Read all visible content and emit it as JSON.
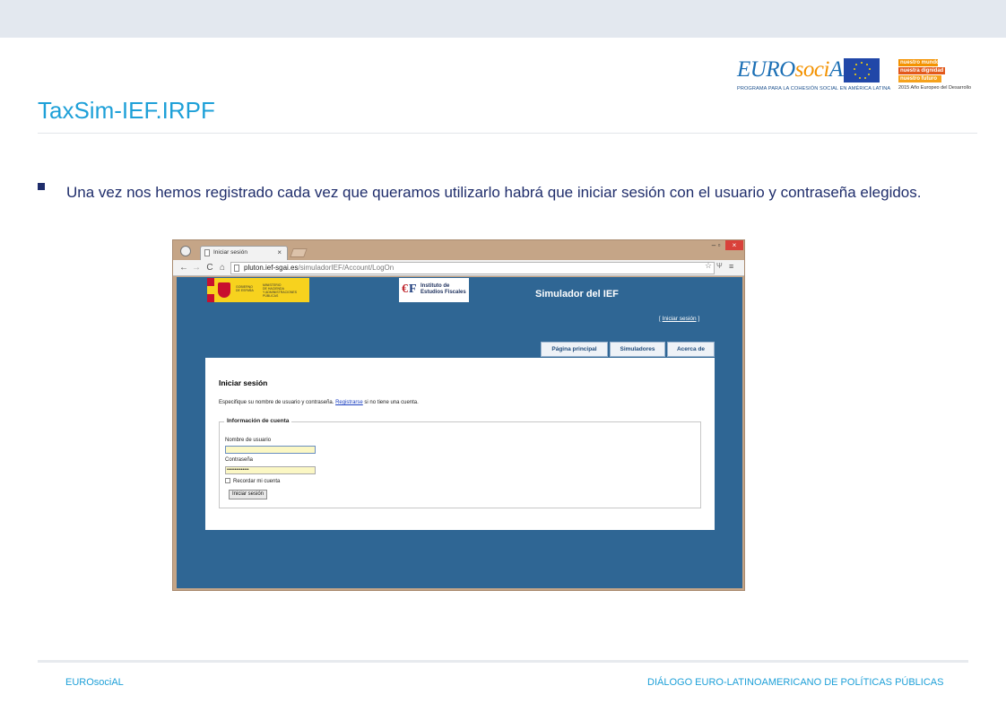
{
  "slide": {
    "title": "TaxSim-IEF.IRPF",
    "bullet": "Una vez nos hemos registrado cada vez que queramos utilizarlo habrá que iniciar sesión con el usuario y contraseña elegidos.",
    "footer_left": "EUROsociAL",
    "footer_right": "DIÁLOGO EURO-LATINOAMERICANO DE POLÍTICAS PÚBLICAS"
  },
  "logos": {
    "eurosocial_eu": "EURO",
    "eurosocial_soc": "soci",
    "eurosocial_al": "AL",
    "eurosocial_tagline": "PROGRAMA PARA LA COHESIÓN SOCIAL EN AMÉRICA LATINA",
    "nuestro_mundo": "nuestro mundo",
    "nuestra_dignidad": "nuestra dignidad",
    "nuestro_futuro": "nuestro futuro",
    "year_text": "2015 Año Europeo del Desarrollo"
  },
  "browser": {
    "tab_title": "Iniciar sesión",
    "tab_close": "×",
    "window_controls": {
      "minimize": "–",
      "maximize": "▫",
      "close": "×"
    },
    "nav": {
      "back": "←",
      "forward": "→",
      "reload": "C",
      "home": "⌂"
    },
    "url_host": "pluton.ief-sgai.es",
    "url_path": "/simuladorIEF/Account/LogOn",
    "star": "☆",
    "ext": "Ψ",
    "menu": "≡"
  },
  "site": {
    "gob_line1": "GOBIERNO\nDE ESPAÑA",
    "gob_line2": "MINISTERIO\nDE HACIENDA\nY ADMINISTRACIONES PÚBLICAS",
    "ief_letters_left": "€",
    "ief_letters_right": "F",
    "ief_name_1": "Instituto de",
    "ief_name_2": "Estudios Fiscales",
    "title": "Simulador del IEF",
    "login_link_open": "[ ",
    "login_link": "Iniciar sesión",
    "login_link_close": " ]",
    "tabs": [
      "Página principal",
      "Simuladores",
      "Acerca de"
    ],
    "heading": "Iniciar sesión",
    "instructions_pre": "Especifique su nombre de usuario y contraseña. ",
    "register_link": "Registrarse",
    "instructions_post": " si no tiene una cuenta.",
    "legend": "Información de cuenta",
    "username_label": "Nombre de usuario",
    "username_value": "",
    "password_label": "Contraseña",
    "password_value": "••••••••••••••",
    "remember_label": "Recordar mi cuenta",
    "submit_label": "Iniciar sesión"
  },
  "colors": {
    "title_blue": "#1ea0d8",
    "bullet_navy": "#1f2d6b",
    "site_blue": "#2f6694",
    "browser_frame": "#c5a587"
  }
}
